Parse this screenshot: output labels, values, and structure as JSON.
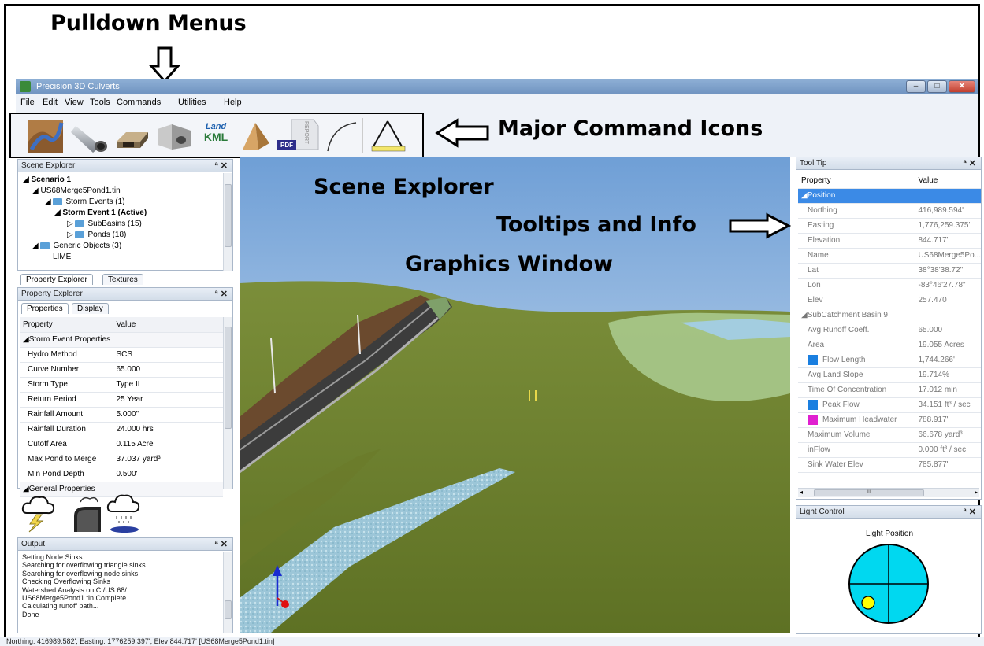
{
  "callouts": {
    "pulldown_menus": "Pulldown Menus",
    "major_command_icons": "Major Command Icons",
    "scene_explorer": "Scene Explorer",
    "tooltips_and_info": "Tooltips and Info",
    "graphics_window": "Graphics Window"
  },
  "window": {
    "title": "Precision 3D Culverts",
    "controls": [
      "minimize-icon",
      "maximize-icon",
      "close-icon"
    ]
  },
  "menu": [
    "File",
    "Edit",
    "View",
    "Tools",
    "Commands",
    "Utilities",
    "Help"
  ],
  "toolbar": {
    "icons": [
      "terrain-icon",
      "culvert-pipe-icon",
      "box-culvert-icon",
      "headwall-icon",
      "land-kml-icon",
      "prism-icon",
      "pdf-report-icon",
      "curve-icon",
      "triangle-ruler-icon"
    ],
    "land_kml_top": "Land",
    "land_kml_bottom": "KML",
    "pdf_label": "PDF",
    "report_label": "REPORT"
  },
  "scene_explorer": {
    "title": "Scene Explorer",
    "items": [
      {
        "label": "Scenario 1",
        "bold": true
      },
      {
        "label": "US68Merge5Pond1.tin",
        "bold": false
      },
      {
        "label": "Storm Events (1)",
        "bold": false
      },
      {
        "label": "Storm Event 1 (Active)",
        "bold": true
      },
      {
        "label": "SubBasins (15)",
        "bold": false
      },
      {
        "label": "Ponds (18)",
        "bold": false
      },
      {
        "label": "Generic Objects (3)",
        "bold": false
      },
      {
        "label": "LIME",
        "bold": false
      }
    ],
    "tabs": [
      "Property Explorer",
      "Textures"
    ]
  },
  "property_explorer": {
    "title": "Property Explorer",
    "tabs": [
      "Properties",
      "Display"
    ],
    "col_property": "Property",
    "col_value": "Value",
    "section_storm": "Storm Event Properties",
    "rows": [
      {
        "k": "Hydro Method",
        "v": "SCS"
      },
      {
        "k": "Curve Number",
        "v": "65.000"
      },
      {
        "k": "Storm Type",
        "v": "Type II"
      },
      {
        "k": "Return Period",
        "v": "25 Year"
      },
      {
        "k": "Rainfall Amount",
        "v": "5.000\""
      },
      {
        "k": "Rainfall Duration",
        "v": "24.000 hrs"
      },
      {
        "k": "Cutoff Area",
        "v": "0.115 Acre"
      },
      {
        "k": "Max Pond to Merge",
        "v": "37.037 yard³"
      },
      {
        "k": "Min Pond Depth",
        "v": "0.500'"
      }
    ],
    "section_general": "General Properties"
  },
  "weather_icons": [
    "storm-cloud-icon",
    "drainage-cloud-icon",
    "rain-pond-cloud-icon"
  ],
  "output": {
    "title": "Output",
    "lines": [
      "Setting Node Sinks",
      "Searching for overflowing triangle sinks",
      "Searching for overflowing node sinks",
      "Checking Overflowing Sinks",
      "Watershed Analysis on C:/US 68/",
      "US68Merge5Pond1.tin Complete",
      "Calculating runoff path...",
      "Done"
    ]
  },
  "tooltip": {
    "title": "Tool Tip",
    "col_property": "Property",
    "col_value": "Value",
    "section_position": "Position",
    "position_rows": [
      {
        "k": "Northing",
        "v": "416,989.594'"
      },
      {
        "k": "Easting",
        "v": "1,776,259.375'"
      },
      {
        "k": "Elevation",
        "v": "844.717'"
      },
      {
        "k": "Name",
        "v": "US68Merge5Po..."
      },
      {
        "k": "Lat",
        "v": "38°38'38.72\""
      },
      {
        "k": "Lon",
        "v": "-83°46'27.78\""
      },
      {
        "k": "Elev",
        "v": "257.470"
      }
    ],
    "section_subcatchment": "SubCatchment Basin 9",
    "sub_rows": [
      {
        "k": "Avg Runoff Coeff.",
        "v": "65.000",
        "swatch": ""
      },
      {
        "k": "Area",
        "v": "19.055 Acres",
        "swatch": ""
      },
      {
        "k": "Flow Length",
        "v": "1,744.266'",
        "swatch": "#1a7fe0"
      },
      {
        "k": "Avg Land Slope",
        "v": "19.714%",
        "swatch": ""
      },
      {
        "k": "Time Of Concentration",
        "v": "17.012 min",
        "swatch": ""
      },
      {
        "k": "Peak Flow",
        "v": "34.151 ft³ / sec",
        "swatch": "#1a7fe0"
      },
      {
        "k": "Maximum Headwater",
        "v": "788.917'",
        "swatch": "#e020d0"
      },
      {
        "k": "Maximum Volume",
        "v": "66.678 yard³",
        "swatch": ""
      },
      {
        "k": "inFlow",
        "v": "0.000 ft³ / sec",
        "swatch": ""
      },
      {
        "k": "Sink Water Elev",
        "v": "785.877'",
        "swatch": ""
      }
    ],
    "scroll_mid": "III"
  },
  "light_control": {
    "title": "Light Control",
    "label": "Light Position",
    "colors": {
      "disc": "#00d8f0",
      "light": "#ffff00"
    }
  },
  "statusbar": "Northing: 416989.582', Easting: 1776259.397', Elev 844.717' [US68Merge5Pond1.tin]"
}
